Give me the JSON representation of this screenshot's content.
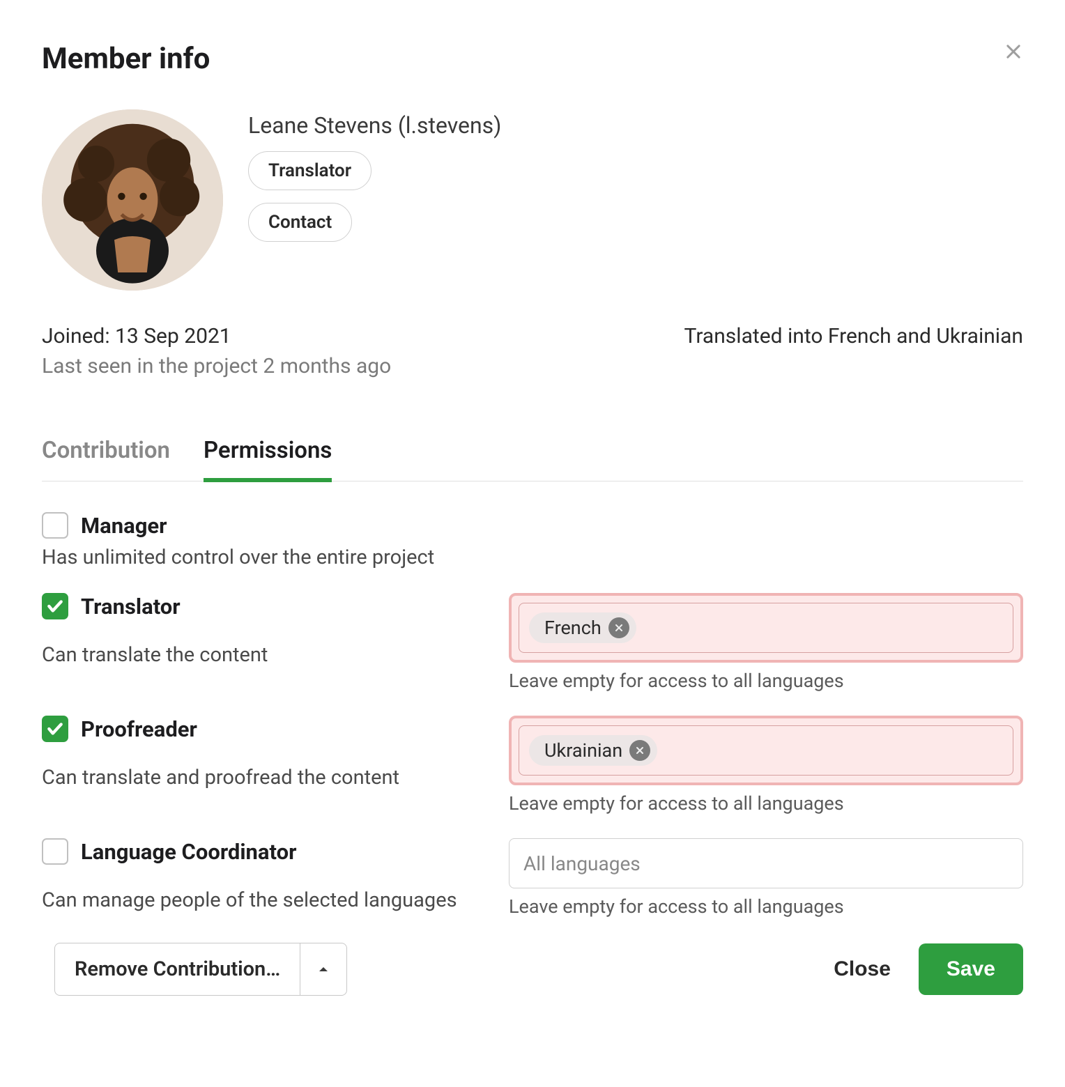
{
  "modal": {
    "title": "Member info"
  },
  "member": {
    "name": "Leane Stevens (l.stevens)",
    "role_btn": "Translator",
    "contact_btn": "Contact",
    "joined": "Joined: 13 Sep 2021",
    "last_seen": "Last seen in the project 2 months ago",
    "translated_into": "Translated into French and Ukrainian"
  },
  "tabs": {
    "contribution": "Contribution",
    "permissions": "Permissions"
  },
  "permissions": {
    "manager": {
      "label": "Manager",
      "desc": "Has unlimited control over the entire project",
      "checked": false
    },
    "translator": {
      "label": "Translator",
      "desc": "Can translate the content",
      "checked": true,
      "chip": "French"
    },
    "proofreader": {
      "label": "Proofreader",
      "desc": "Can translate and proofread the content",
      "checked": true,
      "chip": "Ukrainian"
    },
    "lang_coord": {
      "label": "Language Coordinator",
      "desc": "Can manage people of the selected languages",
      "checked": false,
      "placeholder": "All languages"
    },
    "helper": "Leave empty for access to all languages"
  },
  "footer": {
    "remove": "Remove Contribution…",
    "close": "Close",
    "save": "Save"
  }
}
